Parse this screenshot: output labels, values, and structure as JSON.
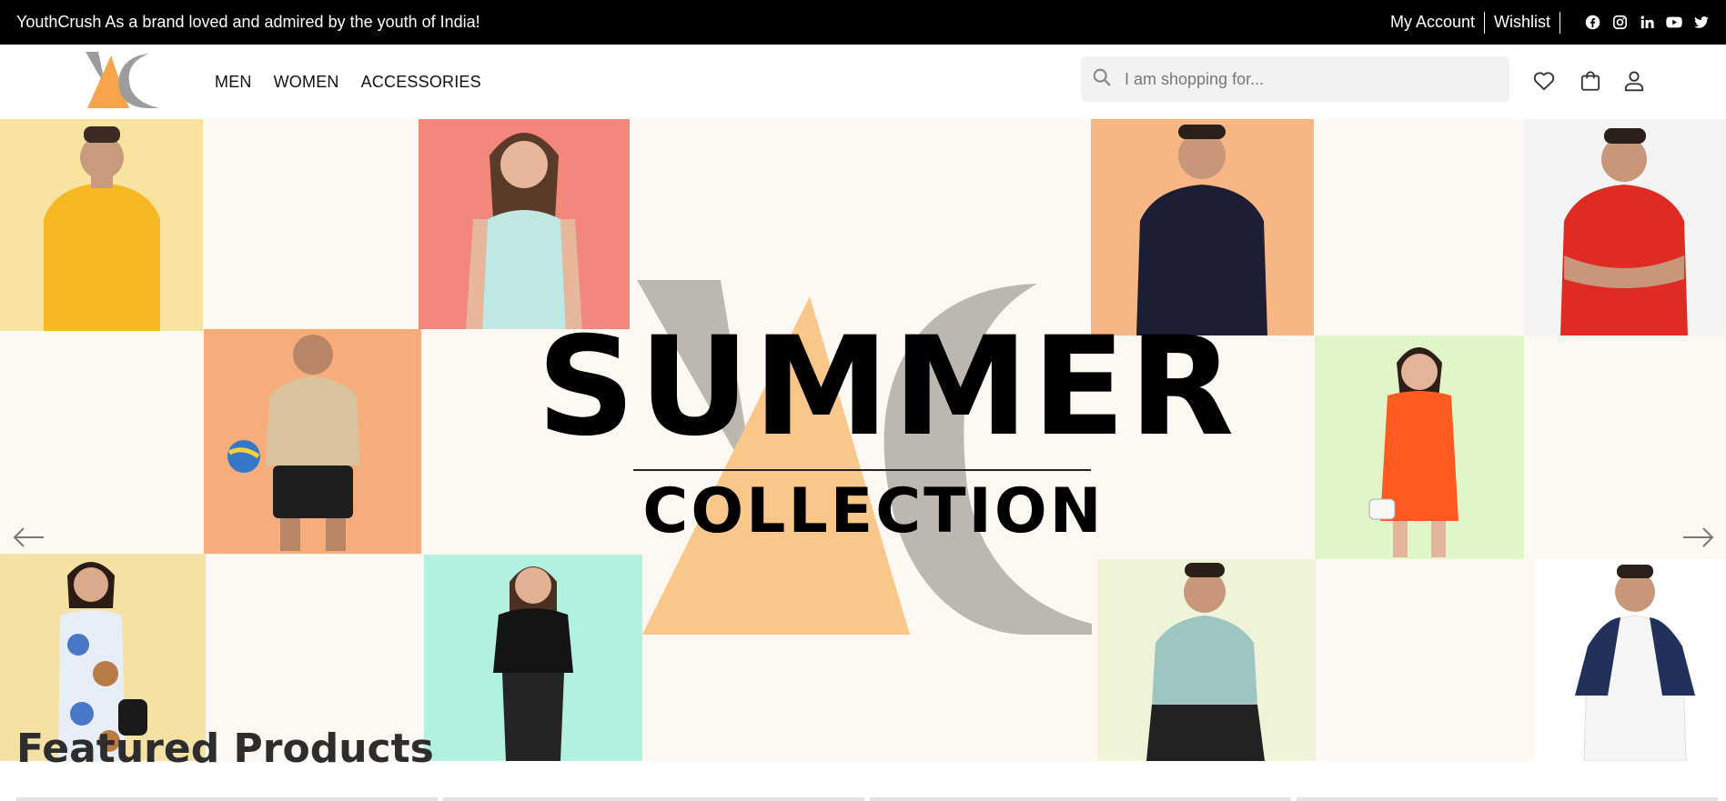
{
  "topbar": {
    "announcement": "YouthCrush As a brand loved and admired by the youth of India!",
    "links": [
      "My Account",
      "Wishlist"
    ],
    "social_icons": [
      "facebook-icon",
      "instagram-icon",
      "linkedin-icon",
      "youtube-icon",
      "twitter-icon"
    ]
  },
  "header": {
    "nav": [
      "MEN",
      "WOMEN",
      "ACCESSORIES"
    ],
    "search_placeholder": "I am shopping for...",
    "icons": [
      "heart-icon",
      "bag-icon",
      "user-icon"
    ]
  },
  "hero": {
    "title": "SUMMER",
    "subtitle": "COLLECTION",
    "icons": [
      "arrow-left-icon",
      "arrow-right-icon"
    ]
  },
  "featured": {
    "title": "Featured Products"
  },
  "colors": {
    "topbar_bg": "#000000",
    "brand_orange": "#f7a54a",
    "brand_gray": "#9c9c9c",
    "hero_bg": "#fdf8f1"
  }
}
